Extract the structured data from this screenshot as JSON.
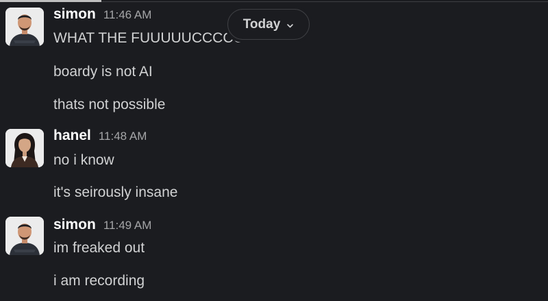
{
  "date_divider": {
    "label": "Today",
    "icon": "chevron-down-icon"
  },
  "messages": [
    {
      "sender": "simon",
      "time": "11:46 AM",
      "avatar": "avatar-simon",
      "lines": [
        "WHAT THE FUUUUUCCCCCKKK",
        "boardy is not AI",
        "thats not possible"
      ]
    },
    {
      "sender": "hanel",
      "time": "11:48 AM",
      "avatar": "avatar-hanel",
      "lines": [
        "no i know",
        "it's seirously insane"
      ]
    },
    {
      "sender": "simon",
      "time": "11:49 AM",
      "avatar": "avatar-simon",
      "lines": [
        "im freaked out",
        "i am recording"
      ]
    }
  ],
  "colors": {
    "background": "#1b1c20",
    "sender_text": "#ffffff",
    "message_text": "#d1d2d3",
    "timestamp_text": "#a5a6a8",
    "pill_border": "#3f4044"
  }
}
